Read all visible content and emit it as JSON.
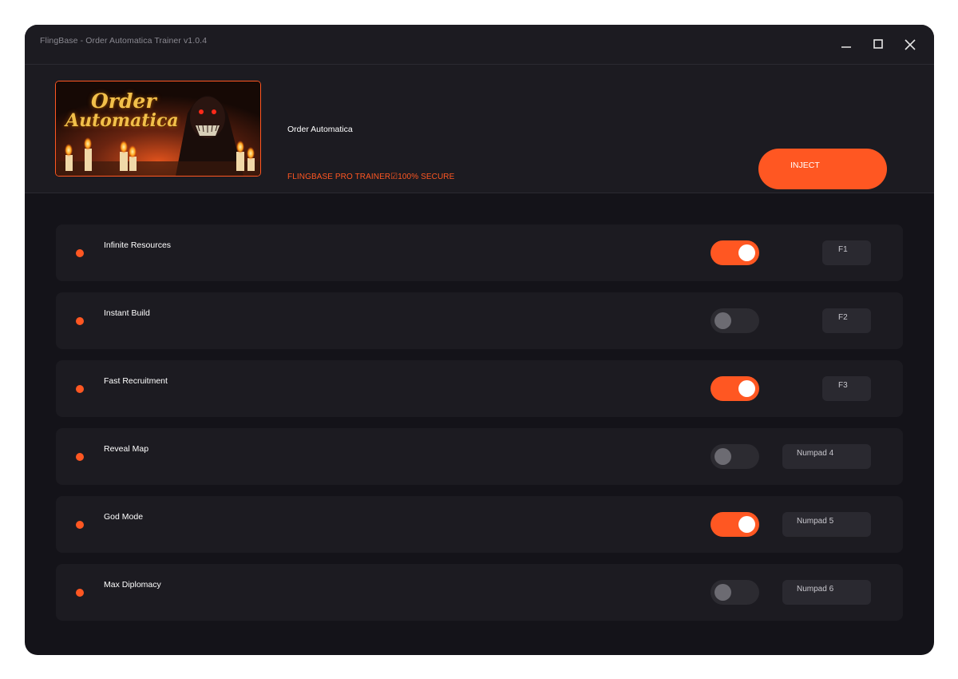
{
  "window": {
    "title": "FlingBase - Order Automatica Trainer v1.0.4"
  },
  "banner": {
    "title_line1": "Order",
    "title_line2": "Automatica"
  },
  "game": {
    "name": "Order Automatica",
    "subtitle": "FLINGBASE PRO TRAINER☑100% SECURE"
  },
  "inject": {
    "label": "INJECT"
  },
  "colors": {
    "accent": "#ff5722",
    "background": "#141319",
    "panel": "#1c1b21"
  },
  "cheats": [
    {
      "label": "Infinite Resources",
      "enabled": true,
      "hotkey": "F1"
    },
    {
      "label": "Instant Build",
      "enabled": false,
      "hotkey": "F2"
    },
    {
      "label": "Fast Recruitment",
      "enabled": true,
      "hotkey": "F3"
    },
    {
      "label": "Reveal Map",
      "enabled": false,
      "hotkey": "Numpad 4"
    },
    {
      "label": "God Mode",
      "enabled": true,
      "hotkey": "Numpad 5"
    },
    {
      "label": "Max Diplomacy",
      "enabled": false,
      "hotkey": "Numpad 6"
    }
  ]
}
